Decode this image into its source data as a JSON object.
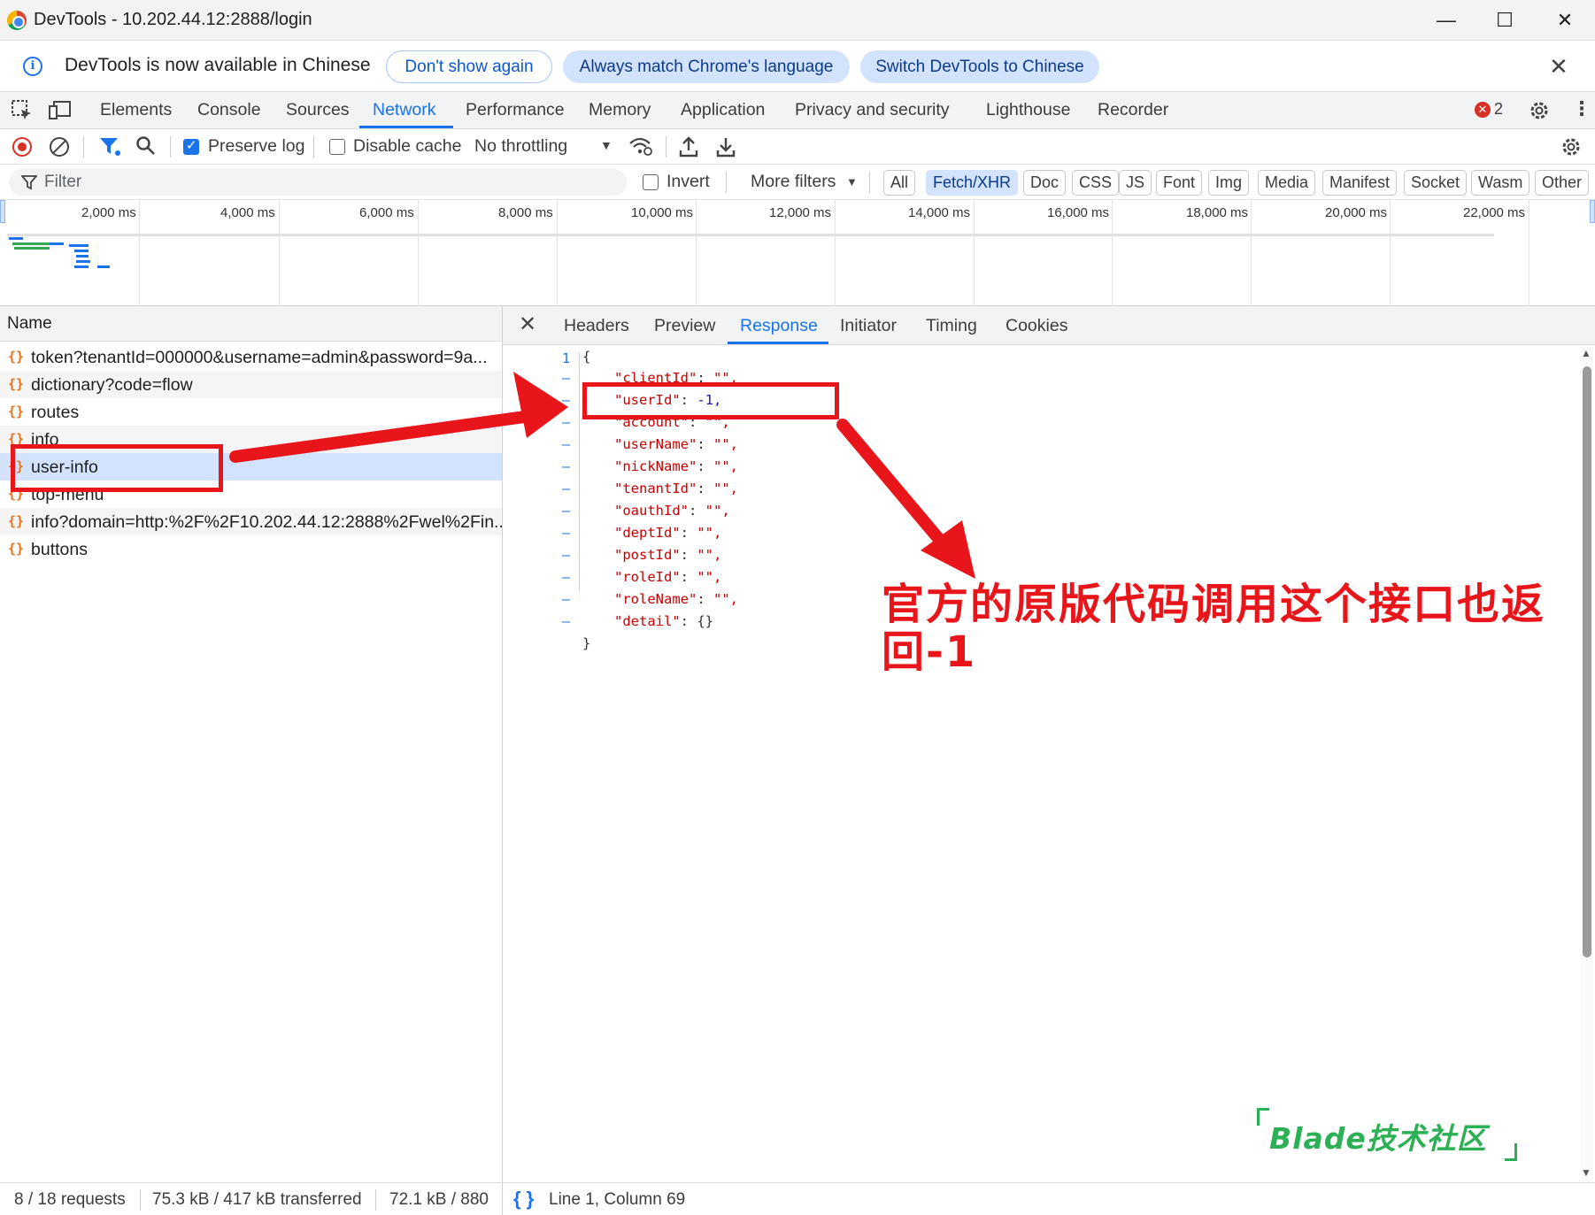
{
  "window": {
    "title": "DevTools - 10.202.44.12:2888/login",
    "minimize": "—",
    "maximize": "☐",
    "close": "✕"
  },
  "infobar": {
    "message": "DevTools is now available in Chinese",
    "dont_show": "Don't show again",
    "always_match": "Always match Chrome's language",
    "switch": "Switch DevTools to Chinese",
    "close": "✕"
  },
  "tabs": [
    "Elements",
    "Console",
    "Sources",
    "Network",
    "Performance",
    "Memory",
    "Application",
    "Privacy and security",
    "Lighthouse",
    "Recorder"
  ],
  "active_tab": "Network",
  "error_count": "2",
  "toolbar": {
    "preserve_log": "Preserve log",
    "disable_cache": "Disable cache",
    "throttling": "No throttling",
    "preserve_log_checked": true,
    "disable_cache_checked": false
  },
  "filter": {
    "placeholder": "Filter",
    "invert": "Invert",
    "more_filters": "More filters",
    "chips": [
      "All",
      "Fetch/XHR",
      "Doc",
      "CSS",
      "JS",
      "Font",
      "Img",
      "Media",
      "Manifest",
      "Socket",
      "Wasm",
      "Other"
    ],
    "active_chip": "Fetch/XHR"
  },
  "overview": {
    "ticks": [
      "2,000 ms",
      "4,000 ms",
      "6,000 ms",
      "8,000 ms",
      "10,000 ms",
      "12,000 ms",
      "14,000 ms",
      "16,000 ms",
      "18,000 ms",
      "20,000 ms",
      "22,000 ms"
    ]
  },
  "requests": {
    "header": "Name",
    "rows": [
      "token?tenantId=000000&username=admin&password=9a...",
      "dictionary?code=flow",
      "routes",
      "info",
      "user-info",
      "top-menu",
      "info?domain=http:%2F%2F10.202.44.12:2888%2Fwel%2Fin...",
      "buttons"
    ],
    "selected": "user-info"
  },
  "detail": {
    "close": "✕",
    "tabs": [
      "Headers",
      "Preview",
      "Response",
      "Initiator",
      "Timing",
      "Cookies"
    ],
    "active_tab": "Response",
    "line_number": "1",
    "code": {
      "open": "{",
      "close": "}",
      "fields": [
        {
          "key": "\"clientId\"",
          "value": "\"\","
        },
        {
          "key": "\"userId\"",
          "value": "-1,"
        },
        {
          "key": "\"account\"",
          "value": "\"\","
        },
        {
          "key": "\"userName\"",
          "value": "\"\","
        },
        {
          "key": "\"nickName\"",
          "value": "\"\","
        },
        {
          "key": "\"tenantId\"",
          "value": "\"\","
        },
        {
          "key": "\"oauthId\"",
          "value": "\"\","
        },
        {
          "key": "\"deptId\"",
          "value": "\"\","
        },
        {
          "key": "\"postId\"",
          "value": "\"\","
        },
        {
          "key": "\"roleId\"",
          "value": "\"\","
        },
        {
          "key": "\"roleName\"",
          "value": "\"\","
        },
        {
          "key": "\"detail\"",
          "value": "{}"
        }
      ]
    }
  },
  "status": {
    "requests": "8 / 18 requests",
    "transferred": "75.3 kB / 417 kB transferred",
    "resources": "72.1 kB / 880",
    "braces": "{ }",
    "position": "Line 1, Column 69"
  },
  "annotation": {
    "text": "官方的原版代码调用这个接口也返回-1",
    "color": "#e8151b"
  },
  "watermark": "Blade技术社区",
  "colors": {
    "accent": "#1a73e8",
    "annotation": "#e8151b",
    "watermark": "#2db055"
  }
}
